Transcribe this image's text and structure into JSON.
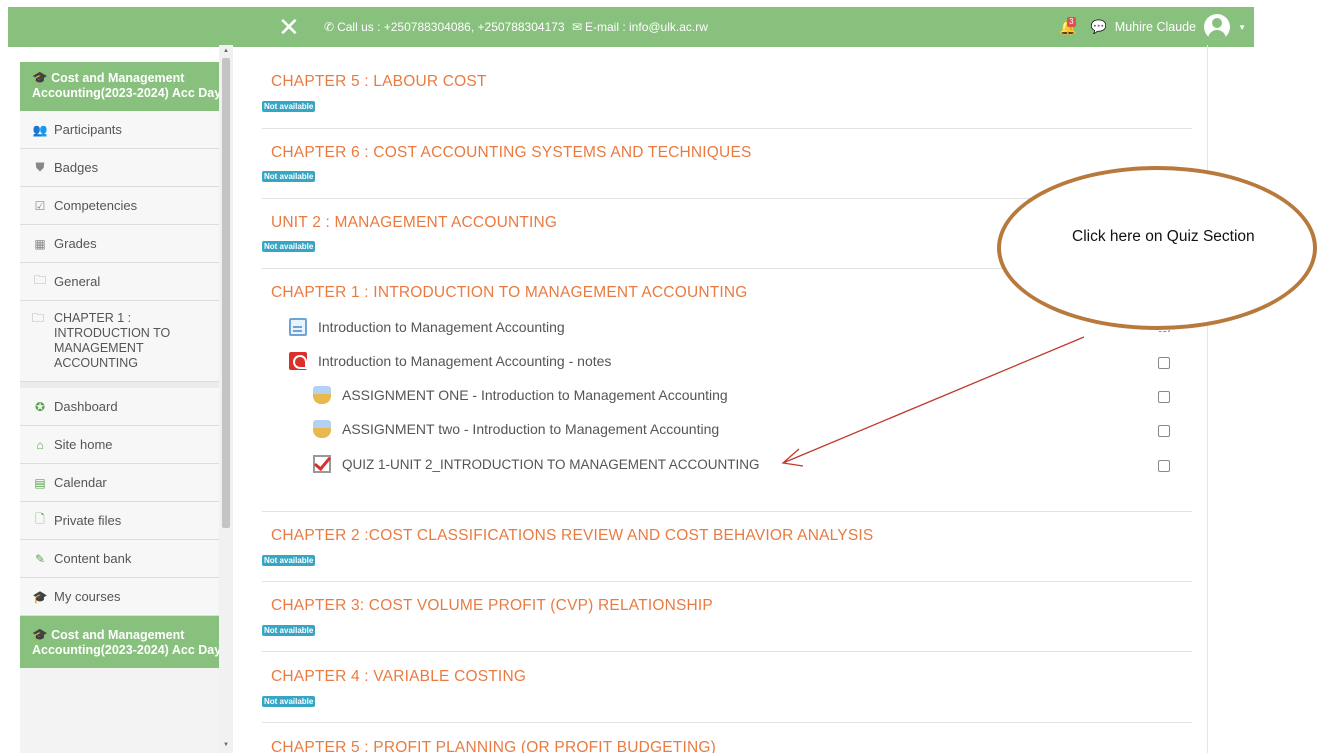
{
  "navbar": {
    "contact_text": "Call us : +250788304086, +250788304173",
    "email_text": "E-mail : info@ulk.ac.rw",
    "notification_count": "3",
    "user_name": "Muhire Claude"
  },
  "sidebar": {
    "course_title": "Cost and Management Accounting(2023-2024) Acc Day",
    "items": [
      {
        "label": "Participants",
        "icon": "users-icon"
      },
      {
        "label": "Badges",
        "icon": "shield-icon"
      },
      {
        "label": "Competencies",
        "icon": "checkbox-icon"
      },
      {
        "label": "Grades",
        "icon": "table-icon"
      },
      {
        "label": "General",
        "icon": "folder-icon"
      }
    ],
    "chapter_item": "CHAPTER 1 : INTRODUCTION TO MANAGEMENT ACCOUNTING",
    "nav_items": [
      {
        "label": "Dashboard",
        "icon": "dashboard-icon"
      },
      {
        "label": "Site home",
        "icon": "home-icon"
      },
      {
        "label": "Calendar",
        "icon": "calendar-icon"
      },
      {
        "label": "Private files",
        "icon": "file-icon"
      },
      {
        "label": "Content bank",
        "icon": "brush-icon"
      },
      {
        "label": "My courses",
        "icon": "graduation-cap-icon"
      }
    ],
    "course_title_bottom": "Cost and Management Accounting(2023-2024) Acc Day"
  },
  "main": {
    "not_available_label": "Not available",
    "sections": [
      {
        "title": "CHAPTER 5 : LABOUR COST"
      },
      {
        "title": "CHAPTER 6 : COST ACCOUNTING SYSTEMS AND TECHNIQUES"
      },
      {
        "title": "UNIT 2 : MANAGEMENT ACCOUNTING"
      },
      {
        "title": "CHAPTER 1 : INTRODUCTION TO MANAGEMENT ACCOUNTING"
      },
      {
        "title": "CHAPTER 2 :COST CLASSIFICATIONS REVIEW AND COST BEHAVIOR ANALYSIS"
      },
      {
        "title": "CHAPTER 3: COST VOLUME PROFIT (CVP) RELATIONSHIP"
      },
      {
        "title": "CHAPTER 4 : VARIABLE COSTING"
      },
      {
        "title": "CHAPTER 5 : PROFIT PLANNING (OR PROFIT BUDGETING)"
      }
    ],
    "activities": [
      {
        "name": "Introduction to Management Accounting",
        "icon": "page-icon"
      },
      {
        "name": "Introduction to Management Accounting - notes",
        "icon": "pdf-icon"
      },
      {
        "name": "ASSIGNMENT ONE - Introduction to Management Accounting",
        "icon": "assignment-icon"
      },
      {
        "name": "ASSIGNMENT two - Introduction to Management Accounting",
        "icon": "assignment-icon"
      },
      {
        "name": "QUIZ 1-UNIT 2_INTRODUCTION TO MANAGEMENT ACCOUNTING",
        "icon": "quiz-icon"
      }
    ]
  },
  "annotation": {
    "text": "Click here on Quiz Section",
    "color": "#b8793c"
  },
  "colors": {
    "brand_green": "#88c07d",
    "section_orange": "#e97b41",
    "badge_blue": "#37a5c4"
  }
}
